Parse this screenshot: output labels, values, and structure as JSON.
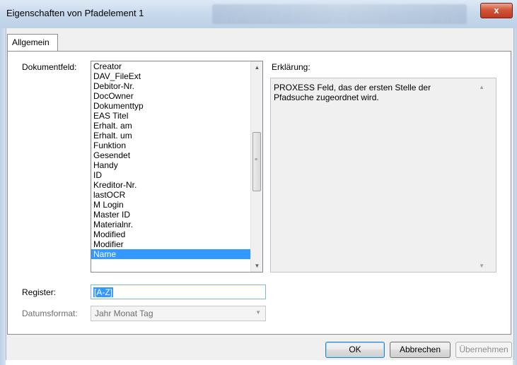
{
  "window": {
    "title": "Eigenschaften von Pfadelement 1",
    "close_label": "x"
  },
  "tabs": [
    {
      "label": "Allgemein",
      "selected": true
    }
  ],
  "form": {
    "dokumentfeld_label": "Dokumentfeld:",
    "erklaerung_label": "Erklärung:",
    "register_label": "Register:",
    "datumsformat_label": "Datumsformat:",
    "fields": [
      "Creator",
      "DAV_FileExt",
      "Debitor-Nr.",
      "DocOwner",
      "Dokumenttyp",
      "EAS Titel",
      "Erhalt. am",
      "Erhalt. um",
      "Funktion",
      "Gesendet",
      "Handy",
      "ID",
      "Kreditor-Nr.",
      "lastOCR",
      "M Login",
      "Master ID",
      "Materialnr.",
      "Modified",
      "Modifier",
      "Name"
    ],
    "selected_field": "Name",
    "explanation_line1": "PROXESS Feld, das der ersten Stelle der",
    "explanation_line2": "Pfadsuche zugeordnet wird.",
    "register_value": "[A-Z]",
    "datumsformat_value": "Jahr Monat Tag"
  },
  "buttons": {
    "ok": "OK",
    "cancel": "Abbrechen",
    "apply": "Übernehmen"
  }
}
